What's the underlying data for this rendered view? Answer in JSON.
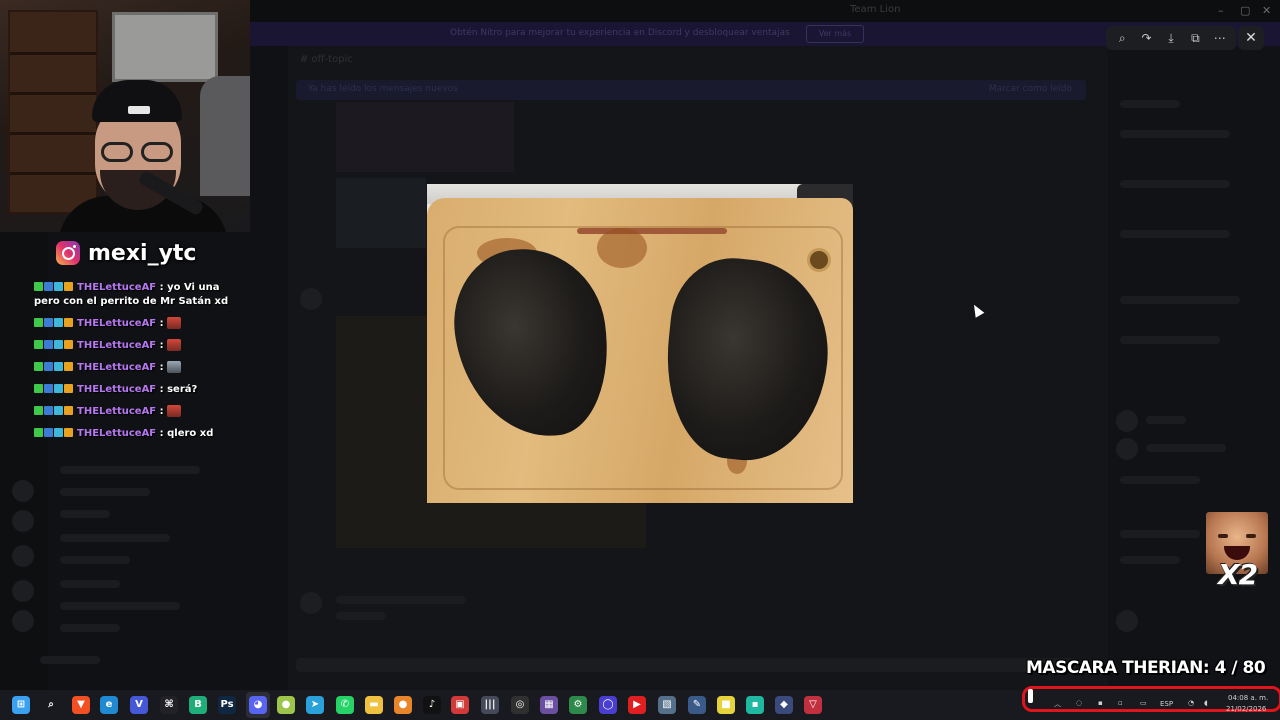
{
  "window": {
    "title": "Team Lion"
  },
  "banner": {
    "text": "Obtén Nitro para mejorar tu experiencia en Discord y desbloquear ventajas",
    "button": "Ver más"
  },
  "channel": {
    "name": "# off-topic"
  },
  "notice": {
    "text": "Ya has leído los mensajes nuevos",
    "right": "Marcar como leído"
  },
  "streamer": {
    "instagram": "mexi_ytc"
  },
  "chat": [
    {
      "user": "THELettuceAF",
      "message": "yo Vi una pero con el perrito de Mr Satán xd",
      "emote": ""
    },
    {
      "user": "THELettuceAF",
      "message": "",
      "emote": "red"
    },
    {
      "user": "THELettuceAF",
      "message": "",
      "emote": "red"
    },
    {
      "user": "THELettuceAF",
      "message": "",
      "emote": "gray"
    },
    {
      "user": "THELettuceAF",
      "message": "será?",
      "emote": ""
    },
    {
      "user": "THELettuceAF",
      "message": "",
      "emote": "red"
    },
    {
      "user": "THELettuceAF",
      "message": "qlero xd",
      "emote": ""
    }
  ],
  "viewer": {
    "tools": [
      "zoom-icon",
      "forward-icon",
      "download-icon",
      "open-external-icon",
      "more-icon"
    ],
    "tool_glyphs": [
      "⌕",
      "↷",
      "⤓",
      "⧉",
      "⋯"
    ],
    "close": "✕"
  },
  "meme_alert": {
    "multiplier": "X2"
  },
  "counter": {
    "label": "MASCARA THERIAN:",
    "current": "4",
    "separator": "/",
    "goal": "80"
  },
  "taskbar": {
    "icons": [
      {
        "name": "windows-start-icon",
        "glyph": "⊞",
        "color": "#3aa0f0"
      },
      {
        "name": "search-icon",
        "glyph": "⌕",
        "color": "#191a1f"
      },
      {
        "name": "brave-icon",
        "glyph": "▼",
        "color": "#f25022"
      },
      {
        "name": "edge-icon",
        "glyph": "e",
        "color": "#1f8ad2"
      },
      {
        "name": "v-app-icon",
        "glyph": "V",
        "color": "#4458d8"
      },
      {
        "name": "capcut-icon",
        "glyph": "⌘",
        "color": "#222226"
      },
      {
        "name": "whatsapp-business-icon",
        "glyph": "B",
        "color": "#1fae7a"
      },
      {
        "name": "photoshop-icon",
        "glyph": "Ps",
        "color": "#0f2740"
      },
      {
        "name": "discord-icon",
        "glyph": "◕",
        "color": "#5865f2"
      },
      {
        "name": "android-icon",
        "glyph": "●",
        "color": "#9cc54a"
      },
      {
        "name": "telegram-icon",
        "glyph": "➤",
        "color": "#2aa1da"
      },
      {
        "name": "whatsapp-icon",
        "glyph": "✆",
        "color": "#25d366"
      },
      {
        "name": "file-explorer-icon",
        "glyph": "▬",
        "color": "#f0c040"
      },
      {
        "name": "app-orange-icon",
        "glyph": "●",
        "color": "#e8852a"
      },
      {
        "name": "tiktok-icon",
        "glyph": "♪",
        "color": "#111"
      },
      {
        "name": "app-red-icon",
        "glyph": "▣",
        "color": "#d23a3a"
      },
      {
        "name": "audio-app-icon",
        "glyph": "|||",
        "color": "#444a5a"
      },
      {
        "name": "obs-icon",
        "glyph": "◎",
        "color": "#303030"
      },
      {
        "name": "app-purple-icon",
        "glyph": "▦",
        "color": "#6b4fa0"
      },
      {
        "name": "app-green-icon",
        "glyph": "⚙",
        "color": "#2e8a4a"
      },
      {
        "name": "app-blue-circle-icon",
        "glyph": "◯",
        "color": "#4a3ed0"
      },
      {
        "name": "youtube-music-icon",
        "glyph": "▶",
        "color": "#e02020"
      },
      {
        "name": "image-app-icon",
        "glyph": "▧",
        "color": "#55708a"
      },
      {
        "name": "pen-app-icon",
        "glyph": "✎",
        "color": "#3a5a8a"
      },
      {
        "name": "sticky-notes-icon",
        "glyph": "■",
        "color": "#e6d23a"
      },
      {
        "name": "twitch-icon",
        "glyph": "▪",
        "color": "#1fb8a0"
      },
      {
        "name": "app-diamond-icon",
        "glyph": "◆",
        "color": "#3a4a7a"
      },
      {
        "name": "app-triangle-icon",
        "glyph": "▽",
        "color": "#c23040"
      }
    ]
  },
  "tray": {
    "lang": "ESP",
    "time": "04:08 a. m.",
    "date": "21/02/2026"
  }
}
